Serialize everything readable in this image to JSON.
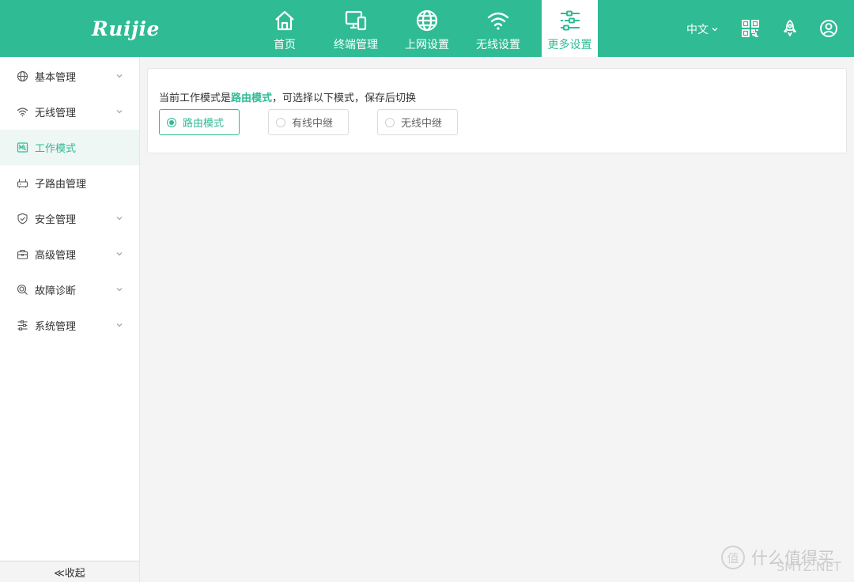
{
  "header": {
    "logo": "Ruijie",
    "nav": [
      {
        "label": "首页",
        "icon": "home-icon"
      },
      {
        "label": "终端管理",
        "icon": "devices-icon"
      },
      {
        "label": "上网设置",
        "icon": "globe-icon"
      },
      {
        "label": "无线设置",
        "icon": "wifi-icon"
      },
      {
        "label": "更多设置",
        "icon": "sliders-icon",
        "active": true
      }
    ],
    "language": "中文",
    "right_icons": [
      "qrcode-icon",
      "rocket-icon",
      "user-icon"
    ]
  },
  "sidebar": {
    "items": [
      {
        "label": "基本管理",
        "icon": "globe-icon",
        "has_submenu": true
      },
      {
        "label": "无线管理",
        "icon": "wifi-icon",
        "has_submenu": true
      },
      {
        "label": "工作模式",
        "icon": "work-mode-icon",
        "active": true
      },
      {
        "label": "子路由管理",
        "icon": "router-icon"
      },
      {
        "label": "安全管理",
        "icon": "shield-icon",
        "has_submenu": true
      },
      {
        "label": "高级管理",
        "icon": "toolbox-icon",
        "has_submenu": true
      },
      {
        "label": "故障诊断",
        "icon": "diagnose-icon",
        "has_submenu": true
      },
      {
        "label": "系统管理",
        "icon": "settings-sliders-icon",
        "has_submenu": true
      }
    ],
    "collapse_label": "≪收起"
  },
  "main": {
    "desc_prefix": "当前工作模式是",
    "desc_mode": "路由模式",
    "desc_suffix": "，可选择以下模式，保存后切换",
    "modes": [
      {
        "label": "路由模式",
        "selected": true
      },
      {
        "label": "有线中继",
        "selected": false
      },
      {
        "label": "无线中继",
        "selected": false
      }
    ]
  },
  "watermark": {
    "logo_char": "值",
    "text": "什么值得买",
    "overlay": "SMYZ.NET"
  },
  "colors": {
    "accent": "#2fbb94",
    "background": "#f4f4f4"
  }
}
